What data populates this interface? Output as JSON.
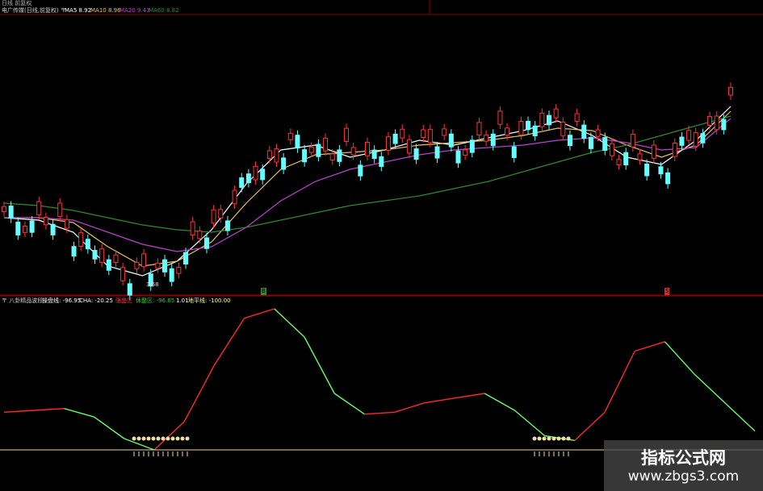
{
  "colors": {
    "background": "#000000",
    "grid": "#8b0000",
    "candle_up": "#ff3333",
    "candle_down": "#66ffff",
    "ma5": "#ffffff",
    "ma10": "#e8c060",
    "ma20": "#c040d0",
    "ma60": "#2e8b2e",
    "osc_up": "#ff2a2a",
    "osc_down": "#66ff66",
    "base_line": "#e8d6a0",
    "signal": "#f0e0a0"
  },
  "top_panel": {
    "header_line1": "日线 前复权",
    "title": "电广传媒(日线,前复权) 〒",
    "ma5": "MA5 8.92",
    "ma10": "MA10 8.96",
    "ma20": "MA20 9.43",
    "ma60": "MA60 8.82",
    "low_marker": "3.68",
    "badge_left": "B",
    "badge_right": "S"
  },
  "bottom_panel": {
    "name": "〒 八卦精品波段",
    "label1": "操盘线: -96.95",
    "label2": "CHA: -20.25",
    "label3": "强盛区",
    "label4": "休整区: -96.65",
    "label5": "1.01",
    "label6": "地平线: -100.00"
  },
  "watermark": {
    "text": "指标公式网",
    "url": "www.zbgs3.com"
  },
  "chart_data": [
    {
      "type": "candlestick",
      "title": "电广传媒(日线,前复权)",
      "series": [
        {
          "name": "MA5",
          "values": [
            9.0,
            8.9,
            8.4,
            7.0,
            6.6,
            7.2,
            8.5,
            10.4,
            11.8,
            12.0,
            11.5,
            11.8,
            12.2,
            12.0,
            12.3,
            12.6,
            13.0,
            12.4,
            11.5,
            11.2,
            12.2,
            13.6
          ]
        },
        {
          "name": "MA10",
          "values": [
            9.0,
            9.0,
            8.8,
            7.8,
            7.0,
            7.2,
            8.0,
            9.6,
            11.0,
            11.6,
            11.7,
            11.8,
            12.0,
            12.1,
            12.2,
            12.4,
            12.7,
            12.6,
            12.0,
            11.5,
            12.0,
            13.4
          ]
        },
        {
          "name": "MA20",
          "values": [
            9.0,
            9.0,
            8.9,
            8.4,
            7.9,
            7.6,
            7.8,
            8.6,
            9.7,
            10.5,
            11.0,
            11.3,
            11.6,
            11.8,
            11.9,
            12.0,
            12.2,
            12.3,
            12.1,
            11.8,
            11.9,
            13.1
          ]
        },
        {
          "name": "MA60",
          "values": [
            9.6,
            9.5,
            9.3,
            9.0,
            8.7,
            8.5,
            8.4,
            8.6,
            8.9,
            9.2,
            9.5,
            9.7,
            9.9,
            10.2,
            10.5,
            10.9,
            11.3,
            11.7,
            12.0,
            12.4,
            12.8,
            13.2
          ]
        }
      ]
    },
    {
      "type": "line",
      "title": "八卦精品波段",
      "series": [
        {
          "name": "操盘线",
          "values": [
            -60,
            -58,
            -56,
            -65,
            -88,
            -100,
            -70,
            -10,
            40,
            50,
            20,
            -40,
            -62,
            -60,
            -50,
            -45,
            -40,
            -58,
            -85,
            -90,
            -60,
            5,
            15,
            -20,
            -50,
            -80
          ]
        },
        {
          "name": "地平线",
          "values": [
            -100
          ]
        }
      ]
    }
  ]
}
